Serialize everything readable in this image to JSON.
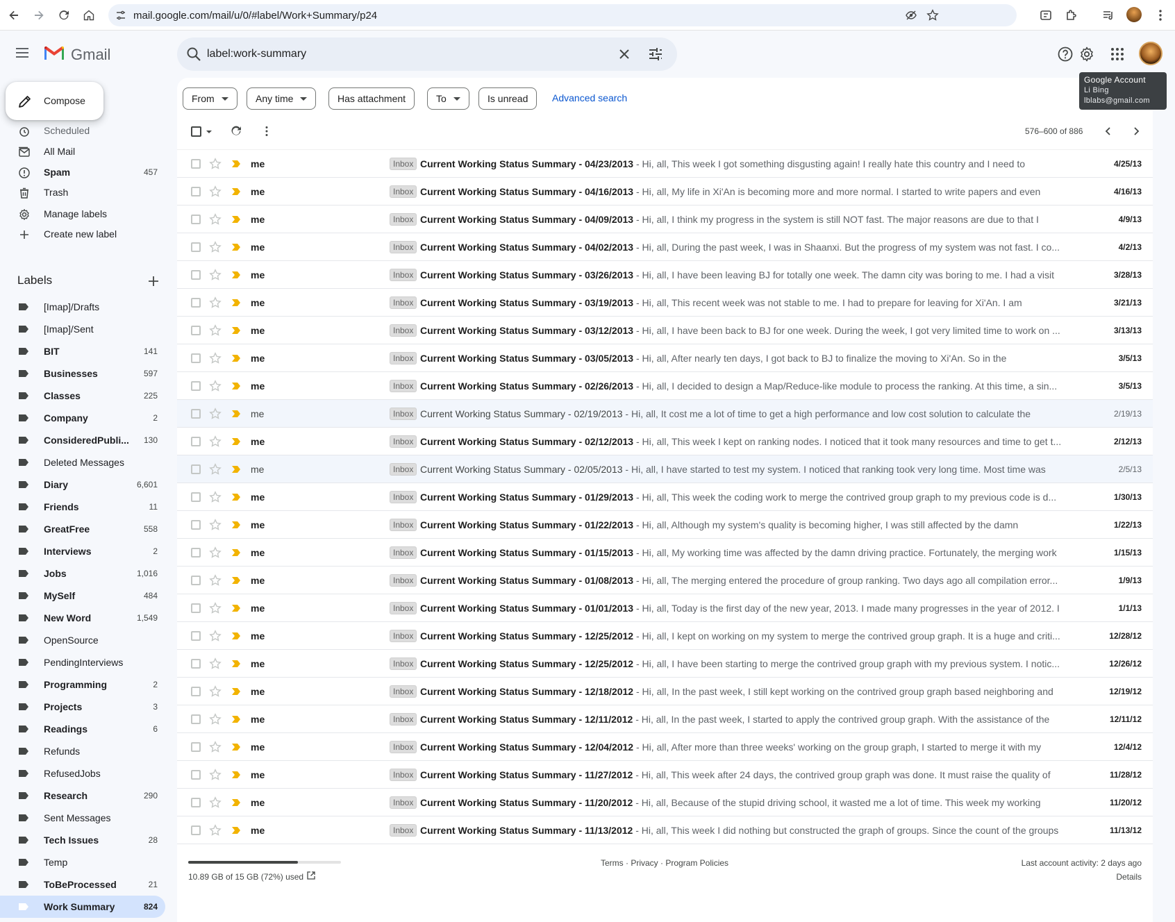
{
  "browser": {
    "url": "mail.google.com/mail/u/0/#label/Work+Summary/p24"
  },
  "header": {
    "app_name": "Gmail",
    "search_query": "label:work-summary",
    "tooltip": {
      "title": "Google Account",
      "name": "Li Bing",
      "email": "lblabs@gmail.com"
    }
  },
  "sidebar": {
    "compose_label": "Compose",
    "system_items": [
      {
        "label": "Scheduled",
        "count": "",
        "icon": "scheduled-icon"
      },
      {
        "label": "All Mail",
        "count": "",
        "icon": "all-mail-icon"
      },
      {
        "label": "Spam",
        "count": "457",
        "icon": "spam-icon"
      },
      {
        "label": "Trash",
        "count": "",
        "icon": "trash-icon"
      },
      {
        "label": "Manage labels",
        "count": "",
        "icon": "gear-icon"
      },
      {
        "label": "Create new label",
        "count": "",
        "icon": "plus-icon"
      }
    ],
    "labels_heading": "Labels",
    "labels": [
      {
        "label": "[Imap]/Drafts",
        "count": ""
      },
      {
        "label": "[Imap]/Sent",
        "count": ""
      },
      {
        "label": "BIT",
        "count": "141"
      },
      {
        "label": "Businesses",
        "count": "597"
      },
      {
        "label": "Classes",
        "count": "225"
      },
      {
        "label": "Company",
        "count": "2"
      },
      {
        "label": "ConsideredPubli...",
        "count": "130"
      },
      {
        "label": "Deleted Messages",
        "count": ""
      },
      {
        "label": "Diary",
        "count": "6,601"
      },
      {
        "label": "Friends",
        "count": "11"
      },
      {
        "label": "GreatFree",
        "count": "558"
      },
      {
        "label": "Interviews",
        "count": "2"
      },
      {
        "label": "Jobs",
        "count": "1,016"
      },
      {
        "label": "MySelf",
        "count": "484"
      },
      {
        "label": "New Word",
        "count": "1,549"
      },
      {
        "label": "OpenSource",
        "count": ""
      },
      {
        "label": "PendingInterviews",
        "count": ""
      },
      {
        "label": "Programming",
        "count": "2"
      },
      {
        "label": "Projects",
        "count": "3"
      },
      {
        "label": "Readings",
        "count": "6"
      },
      {
        "label": "Refunds",
        "count": ""
      },
      {
        "label": "RefusedJobs",
        "count": ""
      },
      {
        "label": "Research",
        "count": "290"
      },
      {
        "label": "Sent Messages",
        "count": ""
      },
      {
        "label": "Tech Issues",
        "count": "28"
      },
      {
        "label": "Temp",
        "count": ""
      },
      {
        "label": "ToBeProcessed",
        "count": "21"
      },
      {
        "label": "Work Summary",
        "count": "824"
      }
    ]
  },
  "filters": {
    "from": "From",
    "any_time": "Any time",
    "has_attachment": "Has attachment",
    "to": "To",
    "is_unread": "Is unread",
    "advanced_search": "Advanced search"
  },
  "toolbar": {
    "pager": "576–600 of 886"
  },
  "emails": [
    {
      "sender": "me",
      "tag": "Inbox",
      "subject": "Current Working Status Summary - 04/23/2013",
      "snippet": " - Hi, all, This week I got something disgusting again! I really hate this country and I need to",
      "date": "4/25/13",
      "unread": true
    },
    {
      "sender": "me",
      "tag": "Inbox",
      "subject": "Current Working Status Summary - 04/16/2013",
      "snippet": " - Hi, all, My life in Xi'An is becoming more and more normal. I started to write papers and even",
      "date": "4/16/13",
      "unread": true
    },
    {
      "sender": "me",
      "tag": "Inbox",
      "subject": "Current Working Status Summary - 04/09/2013",
      "snippet": " - Hi, all, I think my progress in the system is still NOT fast. The major reasons are due to that I",
      "date": "4/9/13",
      "unread": true
    },
    {
      "sender": "me",
      "tag": "Inbox",
      "subject": "Current Working Status Summary - 04/02/2013",
      "snippet": " - Hi, all, During the past week, I was in Shaanxi. But the progress of my system was not fast. I co...",
      "date": "4/2/13",
      "unread": true
    },
    {
      "sender": "me",
      "tag": "Inbox",
      "subject": "Current Working Status Summary - 03/26/2013",
      "snippet": " - Hi, all, I have been leaving BJ for totally one week. The damn city was boring to me. I had a visit",
      "date": "3/28/13",
      "unread": true
    },
    {
      "sender": "me",
      "tag": "Inbox",
      "subject": "Current Working Status Summary - 03/19/2013",
      "snippet": " - Hi, all, This recent week was not stable to me. I had to prepare for leaving for Xi'An. I am",
      "date": "3/21/13",
      "unread": true
    },
    {
      "sender": "me",
      "tag": "Inbox",
      "subject": "Current Working Status Summary - 03/12/2013",
      "snippet": " - Hi, all, I have been back to BJ for one week. During the week, I got very limited time to work on ...",
      "date": "3/13/13",
      "unread": true
    },
    {
      "sender": "me",
      "tag": "Inbox",
      "subject": "Current Working Status Summary - 03/05/2013",
      "snippet": " - Hi, all, After nearly ten days, I got back to BJ to finalize the moving to Xi'An. So in the",
      "date": "3/5/13",
      "unread": true
    },
    {
      "sender": "me",
      "tag": "Inbox",
      "subject": "Current Working Status Summary - 02/26/2013",
      "snippet": " - Hi, all, I decided to design a Map/Reduce-like module to process the ranking. At this time, a sin...",
      "date": "3/5/13",
      "unread": true
    },
    {
      "sender": "me",
      "tag": "Inbox",
      "subject": "Current Working Status Summary - 02/19/2013",
      "snippet": " - Hi, all, It cost me a lot of time to get a high performance and low cost solution to calculate the",
      "date": "2/19/13",
      "unread": false
    },
    {
      "sender": "me",
      "tag": "Inbox",
      "subject": "Current Working Status Summary - 02/12/2013",
      "snippet": " - Hi, all, This week I kept on ranking nodes. I noticed that it took many resources and time to get t...",
      "date": "2/12/13",
      "unread": true
    },
    {
      "sender": "me",
      "tag": "Inbox",
      "subject": "Current Working Status Summary - 02/05/2013",
      "snippet": " - Hi, all, I have started to test my system. I noticed that ranking took very long time. Most time was",
      "date": "2/5/13",
      "unread": false
    },
    {
      "sender": "me",
      "tag": "Inbox",
      "subject": "Current Working Status Summary - 01/29/2013",
      "snippet": " - Hi, all, This week the coding work to merge the contrived group graph to my previous code is d...",
      "date": "1/30/13",
      "unread": true
    },
    {
      "sender": "me",
      "tag": "Inbox",
      "subject": "Current Working Status Summary - 01/22/2013",
      "snippet": " - Hi, all, Although my system's quality is becoming higher, I was still affected by the damn",
      "date": "1/22/13",
      "unread": true
    },
    {
      "sender": "me",
      "tag": "Inbox",
      "subject": "Current Working Status Summary - 01/15/2013",
      "snippet": " - Hi, all, My working time was affected by the damn driving practice. Fortunately, the merging work",
      "date": "1/15/13",
      "unread": true
    },
    {
      "sender": "me",
      "tag": "Inbox",
      "subject": "Current Working Status Summary - 01/08/2013",
      "snippet": " - Hi, all, The merging entered the procedure of group ranking. Two days ago all compilation error...",
      "date": "1/9/13",
      "unread": true
    },
    {
      "sender": "me",
      "tag": "Inbox",
      "subject": "Current Working Status Summary - 01/01/2013",
      "snippet": " - Hi, all, Today is the first day of the new year, 2013. I made many progresses in the year of 2012. I",
      "date": "1/1/13",
      "unread": true
    },
    {
      "sender": "me",
      "tag": "Inbox",
      "subject": "Current Working Status Summary - 12/25/2012",
      "snippet": " - Hi, all, I kept on working on my system to merge the contrived group graph. It is a huge and criti...",
      "date": "12/28/12",
      "unread": true
    },
    {
      "sender": "me",
      "tag": "Inbox",
      "subject": "Current Working Status Summary - 12/25/2012",
      "snippet": " - Hi, all, I have been starting to merge the contrived group graph with my previous system. I notic...",
      "date": "12/26/12",
      "unread": true
    },
    {
      "sender": "me",
      "tag": "Inbox",
      "subject": "Current Working Status Summary - 12/18/2012",
      "snippet": " - Hi, all, In the past week, I still kept working on the contrived group graph based neighboring and",
      "date": "12/19/12",
      "unread": true
    },
    {
      "sender": "me",
      "tag": "Inbox",
      "subject": "Current Working Status Summary - 12/11/2012",
      "snippet": " - Hi, all, In the past week, I started to apply the contrived group graph. With the assistance of the",
      "date": "12/11/12",
      "unread": true
    },
    {
      "sender": "me",
      "tag": "Inbox",
      "subject": "Current Working Status Summary - 12/04/2012",
      "snippet": " - Hi, all, After more than three weeks' working on the group graph, I started to merge it with my",
      "date": "12/4/12",
      "unread": true
    },
    {
      "sender": "me",
      "tag": "Inbox",
      "subject": "Current Working Status Summary - 11/27/2012",
      "snippet": " - Hi, all, This week after 24 days, the contrived group graph was done. It must raise the quality of",
      "date": "11/28/12",
      "unread": true
    },
    {
      "sender": "me",
      "tag": "Inbox",
      "subject": "Current Working Status Summary - 11/20/2012",
      "snippet": " - Hi, all, Because of the stupid driving school, it wasted me a lot of time. This week my working",
      "date": "11/20/12",
      "unread": true
    },
    {
      "sender": "me",
      "tag": "Inbox",
      "subject": "Current Working Status Summary - 11/13/2012",
      "snippet": " - Hi, all, This week I did nothing but constructed the graph of groups. Since the count of the groups",
      "date": "11/13/12",
      "unread": true
    }
  ],
  "footer": {
    "storage_used_fraction": 0.72,
    "storage_text": "10.89 GB of 15 GB (72%) used",
    "links": "Terms · Privacy · Program Policies",
    "last_activity": "Last account activity: 2 days ago",
    "details": "Details"
  },
  "colors": {
    "accent": "#0b57d0",
    "active_label_bg": "#d3e3fd",
    "importance_marker": "#f2b300",
    "app_bg": "#f6f8fc"
  }
}
